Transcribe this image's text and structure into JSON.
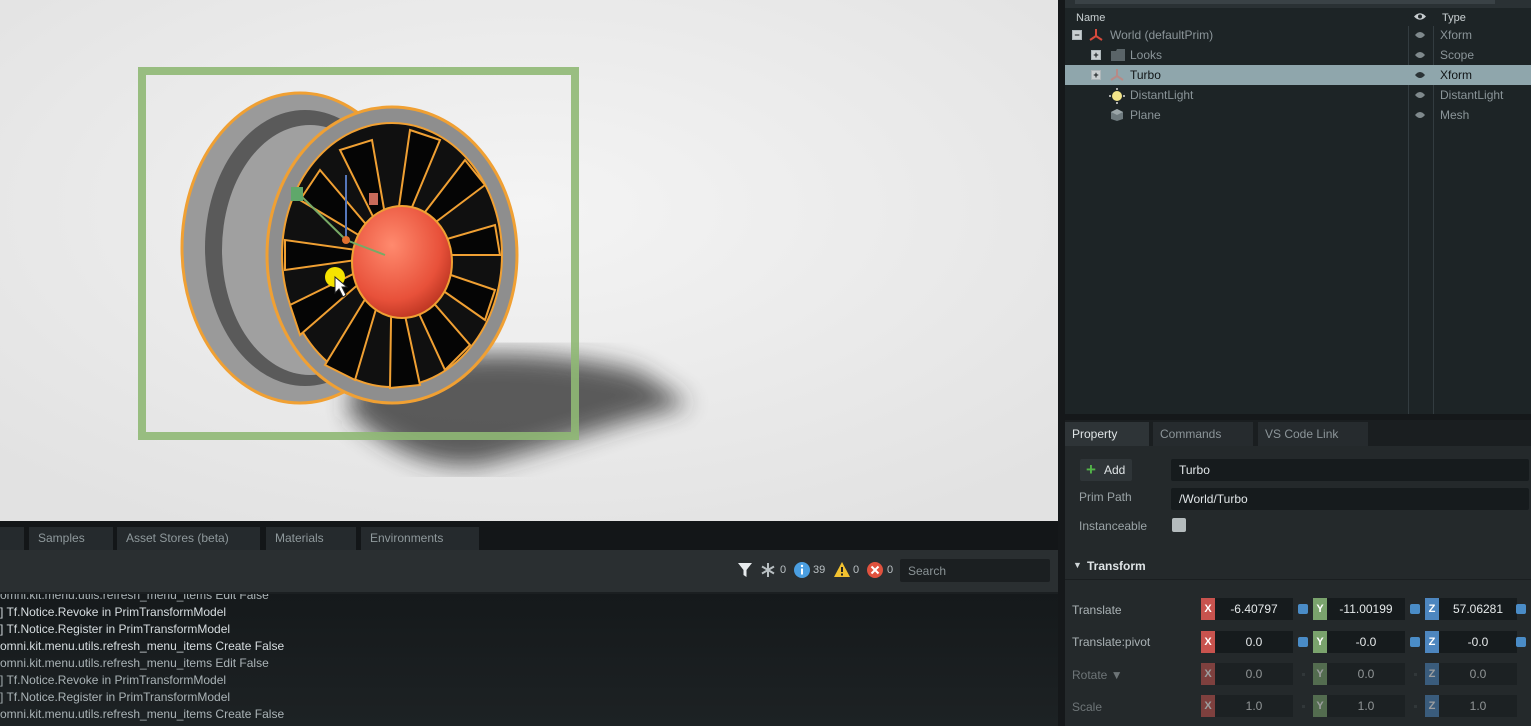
{
  "stage": {
    "columns": {
      "name": "Name",
      "type": "Type"
    },
    "rows": [
      {
        "name": "World (defaultPrim)",
        "type": "Xform",
        "expander": "−"
      },
      {
        "name": "Looks",
        "type": "Scope",
        "expander": "+"
      },
      {
        "name": "Turbo",
        "type": "Xform",
        "expander": "+",
        "selected": true
      },
      {
        "name": "DistantLight",
        "type": "DistantLight"
      },
      {
        "name": "Plane",
        "type": "Mesh"
      }
    ]
  },
  "property": {
    "tabs": [
      "Property",
      "Commands",
      "VS Code Link"
    ],
    "add_label": "Add",
    "name_value": "Turbo",
    "prim_path_label": "Prim Path",
    "prim_path_value": "/World/Turbo",
    "instanceable_label": "Instanceable",
    "transform_header": "Transform",
    "transform": {
      "translate": {
        "label": "Translate",
        "x": "-6.40797",
        "y": "-11.00199",
        "z": "57.06281"
      },
      "translate_pivot": {
        "label": "Translate:pivot",
        "x": "0.0",
        "y": "-0.0",
        "z": "-0.0"
      },
      "rotate": {
        "label": "Rotate ▼",
        "x": "0.0",
        "y": "0.0",
        "z": "0.0"
      },
      "scale": {
        "label": "Scale",
        "x": "1.0",
        "y": "1.0",
        "z": "1.0"
      }
    },
    "axis_letters": {
      "x": "X",
      "y": "Y",
      "z": "Z"
    }
  },
  "bottom": {
    "tabs": [
      "Samples",
      "Asset Stores (beta)",
      "Materials",
      "Environments"
    ],
    "counts": {
      "verbose": "0",
      "info": "39",
      "warning": "0",
      "error": "0"
    },
    "search_placeholder": "Search",
    "log_lines": [
      "omni.kit.menu.utils.refresh_menu_items Edit False",
      "] Tf.Notice.Revoke in PrimTransformModel",
      "] Tf.Notice.Register in PrimTransformModel",
      "omni.kit.menu.utils.refresh_menu_items Create False",
      "omni.kit.menu.utils.refresh_menu_items Edit False",
      "] Tf.Notice.Revoke in PrimTransformModel",
      "] Tf.Notice.Register in PrimTransformModel",
      "omni.kit.menu.utils.refresh_menu_items Create False"
    ]
  },
  "colors": {
    "selection_box": "#8fb874",
    "outline": "#f0a033",
    "selected_row": "#8fa6ac",
    "axis_x": "#c8534e",
    "axis_y": "#7aa36d",
    "axis_z": "#4d86bf"
  },
  "icons": [
    "xform-icon",
    "folder-icon",
    "xform-faded-icon",
    "light-icon",
    "mesh-icon",
    "eye-icon",
    "filter-icon",
    "info-icon",
    "warning-icon",
    "error-icon",
    "asterisk-icon",
    "plus-icon"
  ]
}
